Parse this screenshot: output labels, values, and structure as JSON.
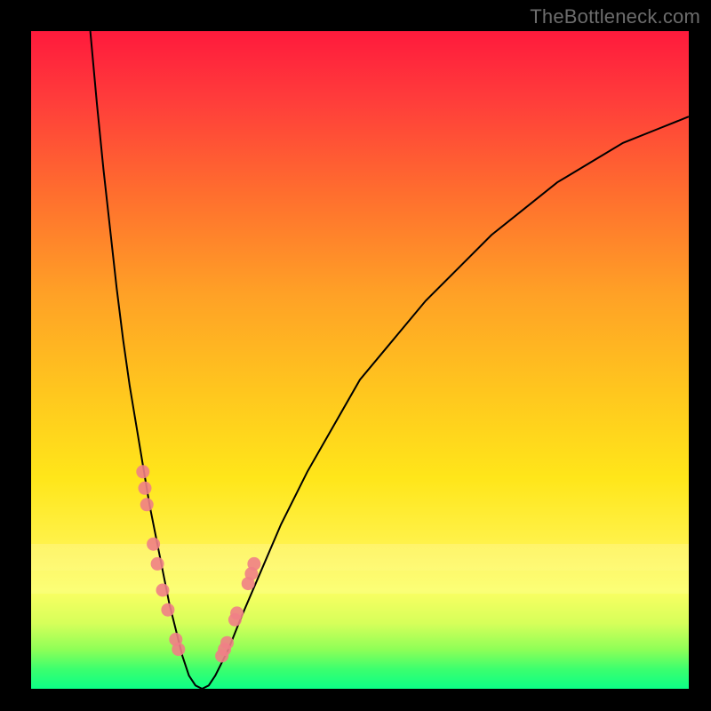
{
  "watermark": "TheBottleneck.com",
  "colors": {
    "frame": "#000000",
    "curve": "#000000",
    "marker_fill": "#f07f86",
    "marker_stroke": "#f07f86"
  },
  "chart_data": {
    "type": "line",
    "title": "",
    "xlabel": "",
    "ylabel": "",
    "xlim": [
      0,
      100
    ],
    "ylim": [
      0,
      100
    ],
    "grid": false,
    "legend": false,
    "background_gradient": [
      "red",
      "orange",
      "yellow",
      "green"
    ],
    "description": "V-shaped bottleneck curve; y≈0 near x≈24, rising steeply on both sides. Left branch reaches y≈100 near x≈9; right branch reaches y≈87 at x=100. Pink dot markers cluster on both branches in the lower region (roughly y between 5 and 32).",
    "series": [
      {
        "name": "curve",
        "x": [
          9,
          10,
          11,
          12,
          13,
          14,
          15,
          16,
          17,
          18,
          19,
          20,
          21,
          22,
          23,
          24,
          25,
          26,
          27,
          28,
          30,
          32,
          35,
          38,
          42,
          46,
          50,
          55,
          60,
          65,
          70,
          75,
          80,
          85,
          90,
          95,
          100
        ],
        "y": [
          100,
          89,
          79,
          70,
          61,
          53,
          46,
          40,
          34,
          28,
          23,
          18,
          13,
          9,
          5,
          2,
          0.5,
          0,
          0.5,
          2,
          6,
          11,
          18,
          25,
          33,
          40,
          47,
          53,
          59,
          64,
          69,
          73,
          77,
          80,
          83,
          85,
          87
        ]
      }
    ],
    "markers": [
      {
        "x": 17.0,
        "y": 33.0
      },
      {
        "x": 17.3,
        "y": 30.5
      },
      {
        "x": 17.6,
        "y": 28.0
      },
      {
        "x": 18.6,
        "y": 22.0
      },
      {
        "x": 19.2,
        "y": 19.0
      },
      {
        "x": 20.0,
        "y": 15.0
      },
      {
        "x": 20.8,
        "y": 12.0
      },
      {
        "x": 22.0,
        "y": 7.5
      },
      {
        "x": 22.4,
        "y": 6.0
      },
      {
        "x": 29.0,
        "y": 5.0
      },
      {
        "x": 29.4,
        "y": 6.0
      },
      {
        "x": 29.8,
        "y": 7.0
      },
      {
        "x": 31.0,
        "y": 10.5
      },
      {
        "x": 31.3,
        "y": 11.5
      },
      {
        "x": 33.0,
        "y": 16.0
      },
      {
        "x": 33.5,
        "y": 17.5
      },
      {
        "x": 33.9,
        "y": 19.0
      }
    ]
  }
}
